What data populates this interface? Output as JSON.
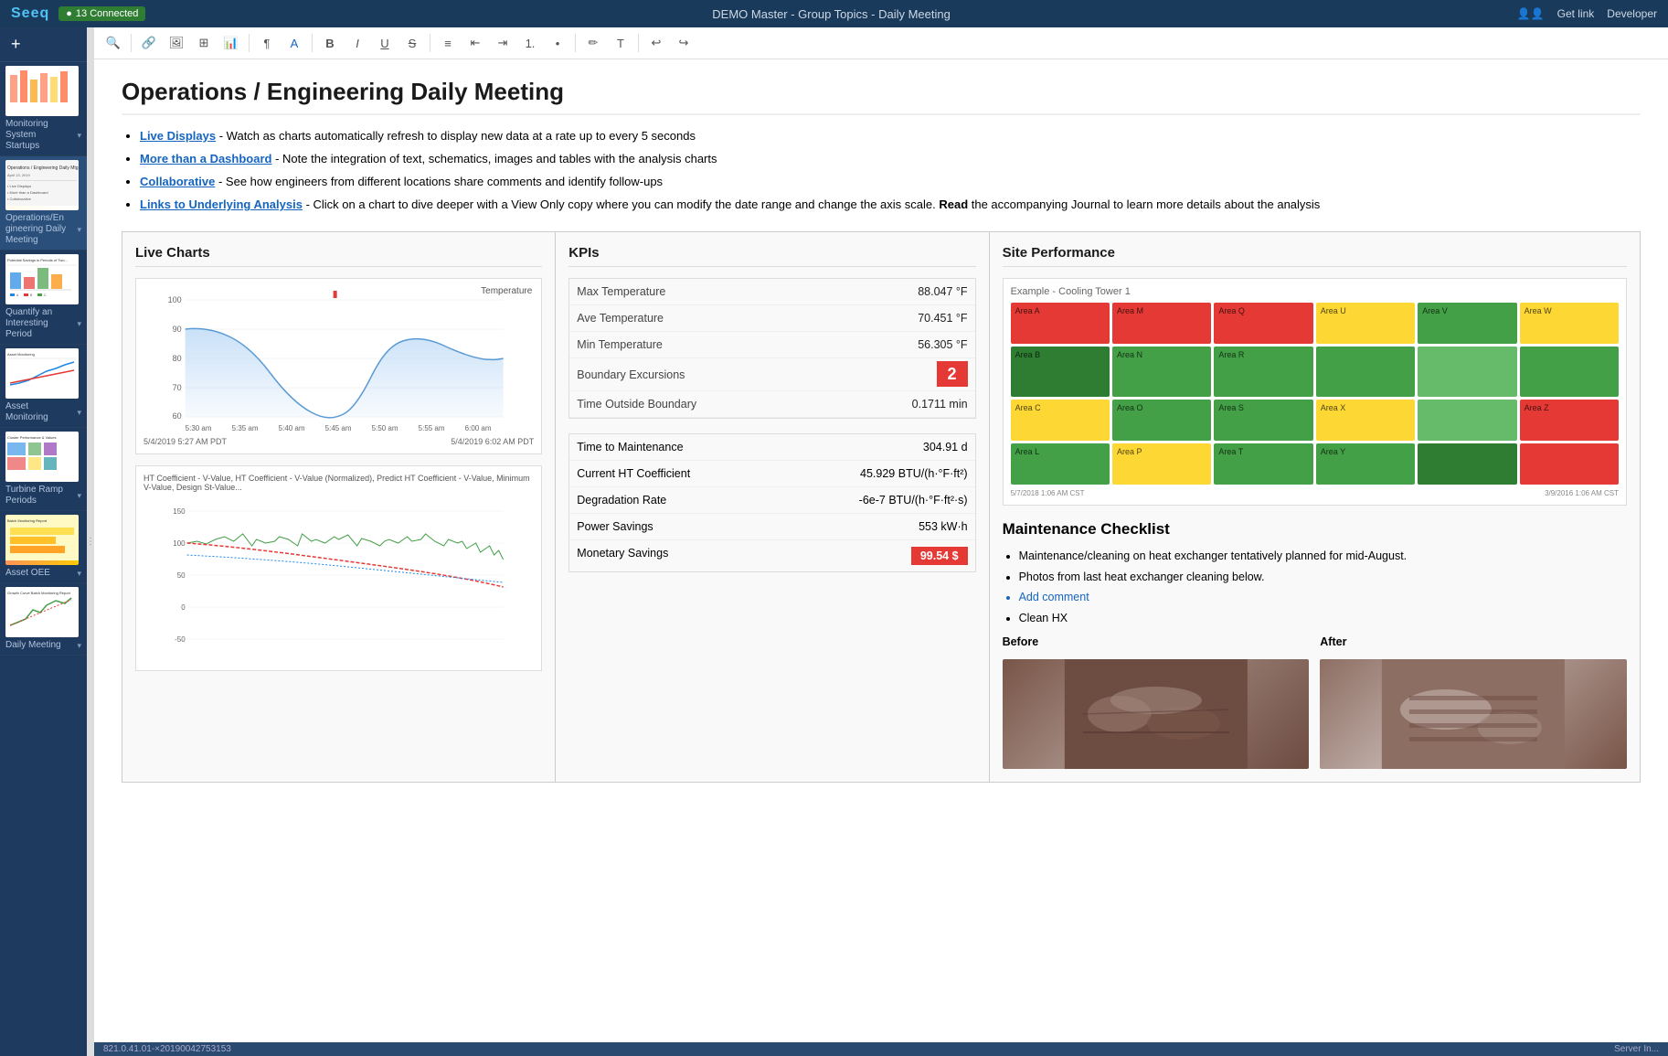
{
  "topbar": {
    "logo": "Seeq",
    "status": "13 Connected",
    "title": "DEMO Master - Group Topics - Daily Meeting",
    "get_link": "Get link",
    "developer": "Developer"
  },
  "sidebar": {
    "add_label": "+",
    "items": [
      {
        "id": "monitoring-system-startups",
        "label": "Monitoring\nSystem\nStartups",
        "active": false
      },
      {
        "id": "operations-engineering-daily-meeting",
        "label": "Operations/Engineering Daily Meeting",
        "active": true
      },
      {
        "id": "quantify-interesting-period",
        "label": "Quantify an Interesting Period",
        "active": false
      },
      {
        "id": "asset-monitoring",
        "label": "Asset Monitoring",
        "active": false
      },
      {
        "id": "turbine-ramp-periods",
        "label": "Turbine Ramp Periods",
        "active": false
      },
      {
        "id": "asset-oee",
        "label": "Asset OEE",
        "active": false
      },
      {
        "id": "daily-meeting",
        "label": "Daily Meeting",
        "active": false
      }
    ]
  },
  "toolbar": {
    "buttons": [
      "search",
      "link",
      "image",
      "table",
      "chart",
      "paragraph",
      "color",
      "bold",
      "italic",
      "underline",
      "strikethrough",
      "align",
      "indent-less",
      "indent-more",
      "list-ordered",
      "list-unordered",
      "highlight",
      "format",
      "undo",
      "redo"
    ]
  },
  "document": {
    "title": "Operations / Engineering Daily Meeting",
    "bullets": [
      {
        "label": "Live Displays",
        "label_style": "link",
        "text": " - Watch as charts automatically refresh to display new data at a rate up to every 5 seconds"
      },
      {
        "label": "More than a Dashboard",
        "label_style": "link",
        "text": " - Note the integration of text, schematics, images and tables with the analysis charts"
      },
      {
        "label": "Collaborative",
        "label_style": "link",
        "text": " - See how engineers from different locations share comments and identify follow-ups"
      },
      {
        "label": "Links to Underlying Analysis",
        "label_style": "link",
        "text": " - Click on a chart to dive deeper with a View Only copy where you can modify the date range and change the axis scale. Read the accompanying Journal to learn more details about the analysis"
      }
    ]
  },
  "live_charts": {
    "title": "Live Charts",
    "chart1": {
      "label": "Temperature",
      "x_labels": [
        "5:30 am",
        "5:35 am",
        "5:40 am",
        "5:45 am",
        "5:50 am",
        "5:55 am",
        "6:00 am"
      ],
      "date_range": "5/4/2019 5:27 AM PDT — 5/4/2019 6:02 AM PDT",
      "y_min": 60,
      "y_max": 100
    },
    "chart2": {
      "legend": "HT Coefficient - V-Value, HT Coefficient - V-Value (Normalized), Predict HT Coefficient - V-Value, Minimum V-Value, Design St-Value...",
      "date_range": ""
    }
  },
  "kpis": {
    "title": "KPIs",
    "rows": [
      {
        "label": "Max Temperature",
        "value": "88.047 °F"
      },
      {
        "label": "Ave Temperature",
        "value": "70.451 °F"
      },
      {
        "label": "Min Temperature",
        "value": "56.305 °F"
      },
      {
        "label": "Boundary Excursions",
        "value": "2",
        "highlight": true
      },
      {
        "label": "Time Outside Boundary",
        "value": "0.1711 min"
      }
    ],
    "bottom_rows": [
      {
        "label": "Time to Maintenance",
        "value": "304.91 d"
      },
      {
        "label": "Current HT Coefficient",
        "value": "45.929 BTU/(h·°F·ft²)"
      },
      {
        "label": "Degradation Rate",
        "value": "-6e-7 BTU/(h·°F·ft²·s)"
      },
      {
        "label": "Power Savings",
        "value": "553 kW·h"
      },
      {
        "label": "Monetary Savings",
        "value": "99.54 $",
        "highlight": true
      }
    ]
  },
  "site_performance": {
    "title": "Site Performance",
    "subtitle": "Example - Cooling Tower 1",
    "heatmap": [
      {
        "id": "A",
        "color": "red"
      },
      {
        "id": "M",
        "color": "red"
      },
      {
        "id": "Q",
        "color": "red"
      },
      {
        "id": "U",
        "color": "yellow"
      },
      {
        "id": "V",
        "color": "green"
      },
      {
        "id": "W",
        "color": "yellow"
      },
      {
        "id": "B",
        "color": "dkgreen"
      },
      {
        "id": "N",
        "color": "green"
      },
      {
        "id": "R",
        "color": "green"
      },
      {
        "id": "",
        "color": "green"
      },
      {
        "id": "",
        "color": "green"
      },
      {
        "id": "",
        "color": "green"
      },
      {
        "id": "C",
        "color": "yellow"
      },
      {
        "id": "O",
        "color": "green"
      },
      {
        "id": "S",
        "color": "green"
      },
      {
        "id": "X",
        "color": "yellow"
      },
      {
        "id": "",
        "color": "green"
      },
      {
        "id": "Z",
        "color": "red"
      },
      {
        "id": "L",
        "color": "green"
      },
      {
        "id": "P",
        "color": "yellow"
      },
      {
        "id": "T",
        "color": "green"
      },
      {
        "id": "Y",
        "color": "green"
      },
      {
        "id": "",
        "color": "green"
      },
      {
        "id": "",
        "color": "red"
      }
    ],
    "timestamp": "5/7/2018 1:06 AM CST — 3/9/2016 1:06 AM CST"
  },
  "maintenance": {
    "title": "Maintenance Checklist",
    "bullets": [
      "Maintenance/cleaning on heat exchanger tentatively planned for mid-August.",
      "Photos from last heat exchanger cleaning below.",
      "Add comment",
      "Clean HX"
    ],
    "before_label": "Before",
    "after_label": "After"
  },
  "statusbar": {
    "version": "821.0.41.01-×20190042753153",
    "server": "Server In..."
  }
}
